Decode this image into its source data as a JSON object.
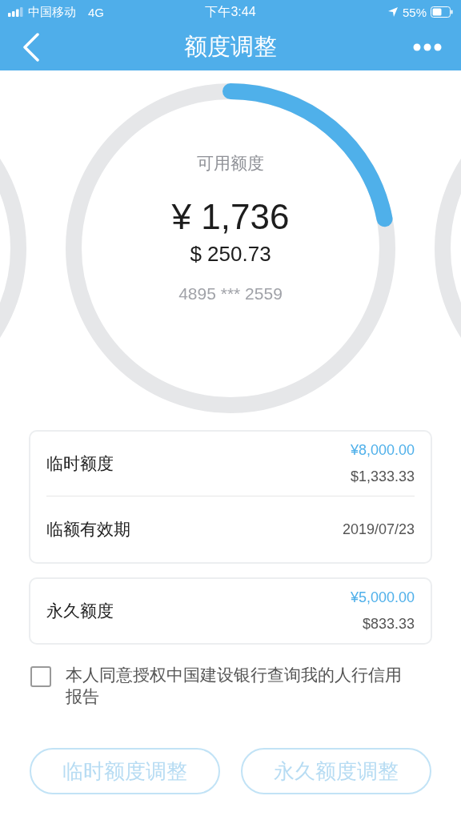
{
  "status_bar": {
    "carrier": "中国移动",
    "network": "4G",
    "time": "下午3:44",
    "battery": "55%"
  },
  "nav": {
    "title": "额度调整"
  },
  "ring": {
    "label": "可用额度",
    "amount_cny": "¥ 1,736",
    "amount_usd": "$ 250.73",
    "card_number": "4895 *** 2559"
  },
  "cards": [
    {
      "rows": [
        {
          "kind": "amount",
          "label": "临时额度",
          "value_cny": "¥8,000.00",
          "value_usd": "$1,333.33"
        },
        {
          "kind": "date",
          "label": "临额有效期",
          "value": "2019/07/23"
        }
      ]
    },
    {
      "rows": [
        {
          "kind": "amount",
          "label": "永久额度",
          "value_cny": "¥5,000.00",
          "value_usd": "$833.33"
        }
      ]
    }
  ],
  "consent": {
    "checked": false,
    "text": "本人同意授权中国建设银行查询我的人行信用报告"
  },
  "buttons": [
    {
      "label": "临时额度调整",
      "disabled": true
    },
    {
      "label": "永久额度调整",
      "disabled": true
    }
  ]
}
